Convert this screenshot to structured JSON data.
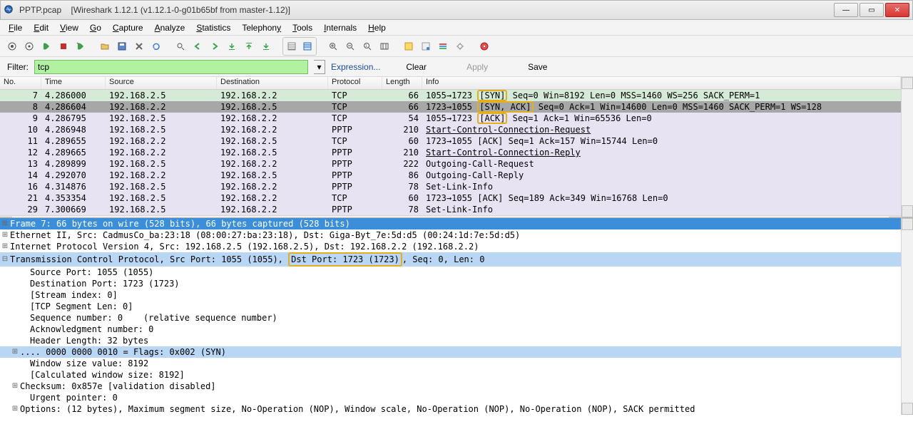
{
  "title": {
    "file": "PPTP.pcap",
    "app": "[Wireshark 1.12.1  (v1.12.1-0-g01b65bf from master-1.12)]"
  },
  "menu": [
    "File",
    "Edit",
    "View",
    "Go",
    "Capture",
    "Analyze",
    "Statistics",
    "Telephony",
    "Tools",
    "Internals",
    "Help"
  ],
  "filter": {
    "label": "Filter:",
    "value": "tcp",
    "expression": "Expression...",
    "clear": "Clear",
    "apply": "Apply",
    "save": "Save"
  },
  "columns": [
    "No.",
    "Time",
    "Source",
    "Destination",
    "Protocol",
    "Length",
    "Info"
  ],
  "packets": [
    {
      "no": "7",
      "time": "4.286000",
      "src": "192.168.2.5",
      "dst": "192.168.2.2",
      "prot": "TCP",
      "len": "66",
      "info_pre": "1055→1723 ",
      "info_hl": "[SYN]",
      "info_post": " Seq=0 Win=8192 Len=0 MSS=1460 WS=256 SACK_PERM=1",
      "style": "sel-primary"
    },
    {
      "no": "8",
      "time": "4.286604",
      "src": "192.168.2.2",
      "dst": "192.168.2.5",
      "prot": "TCP",
      "len": "66",
      "info_pre": "1723→1055 ",
      "info_hl": "[SYN, ACK]",
      "info_post": " Seq=0 Ack=1 Win=14600 Len=0 MSS=1460 SACK_PERM=1 WS=128",
      "style": "sel-dark"
    },
    {
      "no": "9",
      "time": "4.286795",
      "src": "192.168.2.5",
      "dst": "192.168.2.2",
      "prot": "TCP",
      "len": "54",
      "info_pre": "1055→1723 ",
      "info_hl": "[ACK]",
      "info_post": " Seq=1 Ack=1 Win=65536 Len=0",
      "style": "sel-light"
    },
    {
      "no": "10",
      "time": "4.286948",
      "src": "192.168.2.5",
      "dst": "192.168.2.2",
      "prot": "PPTP",
      "len": "210",
      "info_pre": "",
      "info_link": "Start-Control-Connection-Request",
      "info_post": "",
      "style": "sel-light"
    },
    {
      "no": "11",
      "time": "4.289655",
      "src": "192.168.2.2",
      "dst": "192.168.2.5",
      "prot": "TCP",
      "len": "60",
      "info_pre": "1723→1055 [ACK] Seq=1 Ack=157 Win=15744 Len=0",
      "style": "sel-light"
    },
    {
      "no": "12",
      "time": "4.289665",
      "src": "192.168.2.2",
      "dst": "192.168.2.5",
      "prot": "PPTP",
      "len": "210",
      "info_pre": "",
      "info_link": "Start-Control-Connection-Reply",
      "info_post": "",
      "style": "sel-light"
    },
    {
      "no": "13",
      "time": "4.289899",
      "src": "192.168.2.5",
      "dst": "192.168.2.2",
      "prot": "PPTP",
      "len": "222",
      "info_pre": "Outgoing-Call-Request",
      "style": "sel-light"
    },
    {
      "no": "14",
      "time": "4.292070",
      "src": "192.168.2.2",
      "dst": "192.168.2.5",
      "prot": "PPTP",
      "len": "86",
      "info_pre": "Outgoing-Call-Reply",
      "style": "sel-light"
    },
    {
      "no": "16",
      "time": "4.314876",
      "src": "192.168.2.5",
      "dst": "192.168.2.2",
      "prot": "PPTP",
      "len": "78",
      "info_pre": "Set-Link-Info",
      "style": "sel-light"
    },
    {
      "no": "21",
      "time": "4.353354",
      "src": "192.168.2.5",
      "dst": "192.168.2.2",
      "prot": "TCP",
      "len": "60",
      "info_pre": "1723→1055 [ACK] Seq=189 Ack=349 Win=16768 Len=0",
      "style": "sel-light"
    },
    {
      "no": "29",
      "time": "7.300669",
      "src": "192.168.2.5",
      "dst": "192.168.2.2",
      "prot": "PPTP",
      "len": "78",
      "info_pre": "Set-Link-Info",
      "style": "sel-light"
    }
  ],
  "details": [
    {
      "exp": "⊞",
      "cls": "dt-sel-dark",
      "text": "Frame 7: 66 bytes on wire (528 bits), 66 bytes captured (528 bits)"
    },
    {
      "exp": "⊞",
      "cls": "",
      "text": "Ethernet II, Src: CadmusCo_ba:23:18 (08:00:27:ba:23:18), Dst: Giga-Byt_7e:5d:d5 (00:24:1d:7e:5d:d5)"
    },
    {
      "exp": "⊞",
      "cls": "",
      "text": "Internet Protocol Version 4, Src: 192.168.2.5 (192.168.2.5), Dst: 192.168.2.2 (192.168.2.2)"
    },
    {
      "exp": "⊟",
      "cls": "dt-sel-light",
      "text_pre": "Transmission Control Protocol, Src Port: 1055 (1055), ",
      "text_hl": "Dst Port: 1723 (1723)",
      "text_post": ", Seq: 0, Len: 0"
    },
    {
      "indent": 2,
      "text": "Source Port: 1055 (1055)"
    },
    {
      "indent": 2,
      "text": "Destination Port: 1723 (1723)"
    },
    {
      "indent": 2,
      "text": "[Stream index: 0]"
    },
    {
      "indent": 2,
      "text": "[TCP Segment Len: 0]"
    },
    {
      "indent": 2,
      "text": "Sequence number: 0    (relative sequence number)"
    },
    {
      "indent": 2,
      "text": "Acknowledgment number: 0"
    },
    {
      "indent": 2,
      "text": "Header Length: 32 bytes"
    },
    {
      "exp": "⊞",
      "cls": "dt-sel-light",
      "indent": 1,
      "text": ".... 0000 0000 0010 = Flags: 0x002 (SYN)"
    },
    {
      "indent": 2,
      "text": "Window size value: 8192"
    },
    {
      "indent": 2,
      "text": "[Calculated window size: 8192]"
    },
    {
      "exp": "⊞",
      "indent": 1,
      "text": "Checksum: 0x857e [validation disabled]"
    },
    {
      "indent": 2,
      "text": "Urgent pointer: 0"
    },
    {
      "exp": "⊞",
      "indent": 1,
      "text": "Options: (12 bytes), Maximum segment size, No-Operation (NOP), Window scale, No-Operation (NOP), No-Operation (NOP), SACK permitted"
    }
  ]
}
